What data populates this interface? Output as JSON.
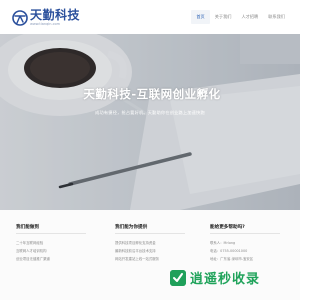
{
  "header": {
    "logo_name": "天勤科技",
    "logo_url": "www.tianqin.com",
    "nav": [
      {
        "label": "首页",
        "active": true
      },
      {
        "label": "关于我们",
        "active": false
      },
      {
        "label": "人才招聘",
        "active": false
      },
      {
        "label": "联系我们",
        "active": false
      }
    ]
  },
  "hero": {
    "title": "天勤科技-互联网创业孵化",
    "subtitle": "成功有捷径，抢占要好机。天勤助你在创业路上加速快跑"
  },
  "footer": {
    "col1": {
      "title": "我们能做到",
      "items": [
        "二十年互联网经验",
        "互联网人才培训机构",
        "创业项目无缝推广渠道"
      ]
    },
    "col2": {
      "title": "我们能为你提供",
      "items": [
        "提供科技项目孵化支持资金",
        "最新科技前沿平台技术支持",
        "网站开发建站上线一站式服务"
      ]
    },
    "col3": {
      "title": "能给更多帮助吗?",
      "items": [
        "联系人：Mrlong",
        "电话：0755-00001000",
        "地址：广东省-深圳市-宝安区"
      ]
    }
  },
  "watermark": {
    "text": "逍遥秒收录"
  },
  "colors": {
    "brand_blue": "#2a4f9c",
    "nav_active": "#2c62b5",
    "watermark_green": "#20a35b"
  }
}
